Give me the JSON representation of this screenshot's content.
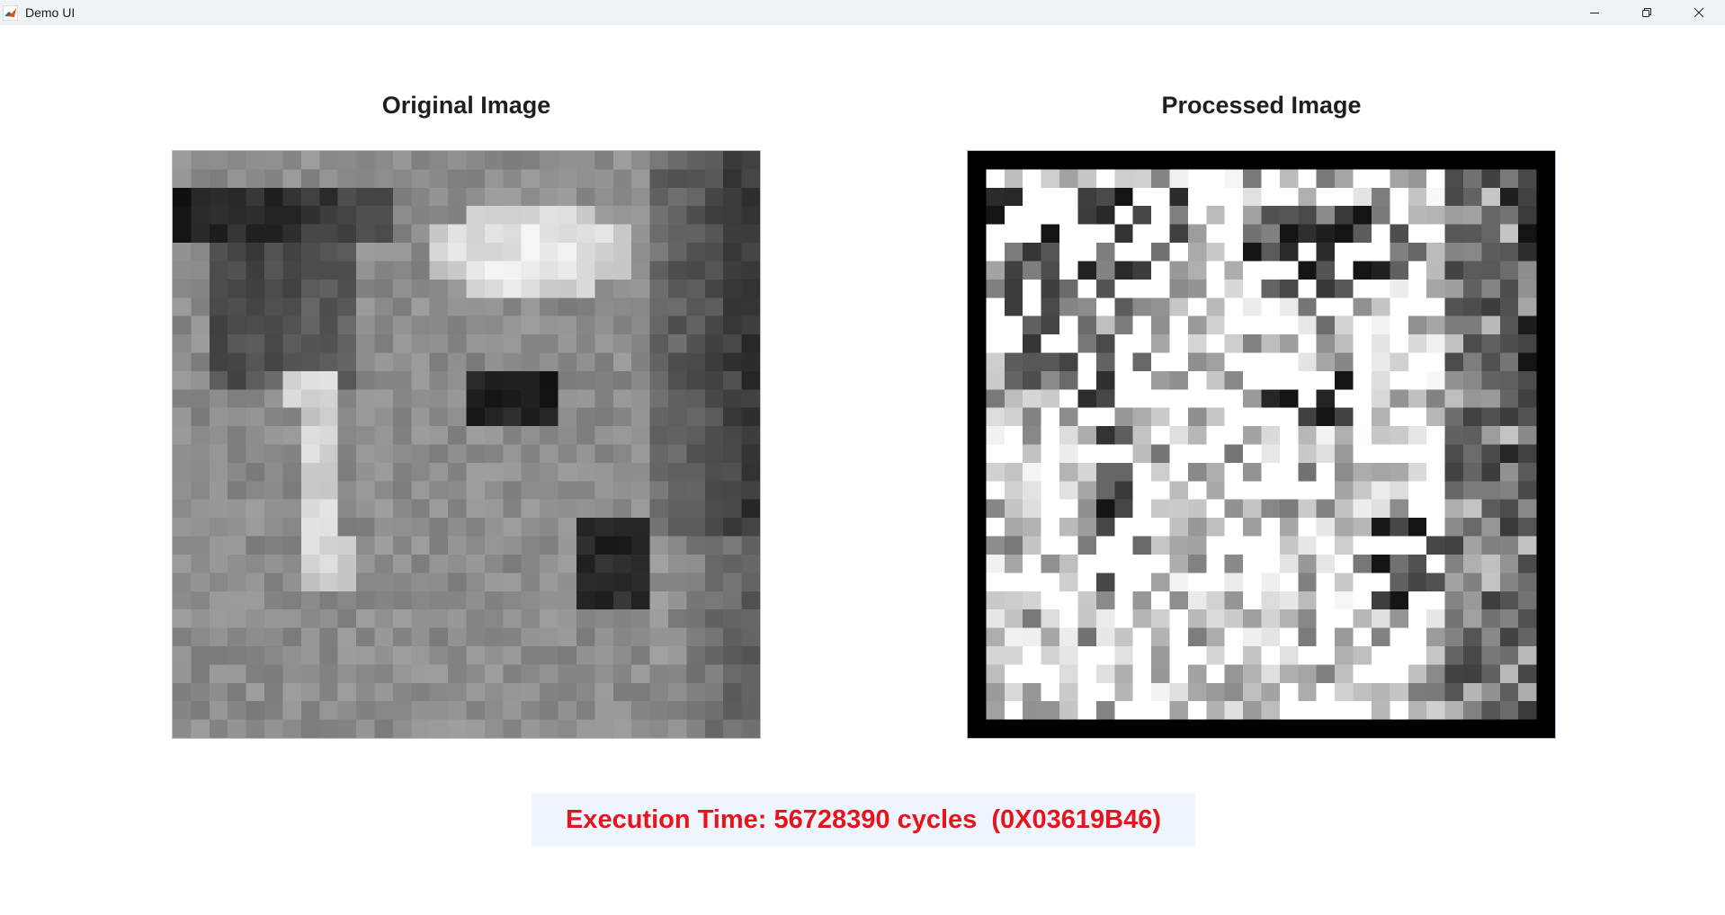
{
  "window": {
    "title": "Demo UI",
    "controls": [
      "minimize",
      "restore",
      "close"
    ]
  },
  "panels": {
    "original": {
      "title": "Original Image",
      "grid_size": 32,
      "description": "grayscale 32x32 pixelated photo"
    },
    "processed": {
      "title": "Processed Image",
      "grid_size": 32,
      "border_color": "#000000"
    }
  },
  "status": {
    "execution_time": "Execution Time: 56728390 cycles  (0X03619B46)"
  },
  "colors": {
    "accent_text": "#e8141c",
    "status_background": "#eef5fc",
    "titlebar_background": "#eef3f8"
  }
}
